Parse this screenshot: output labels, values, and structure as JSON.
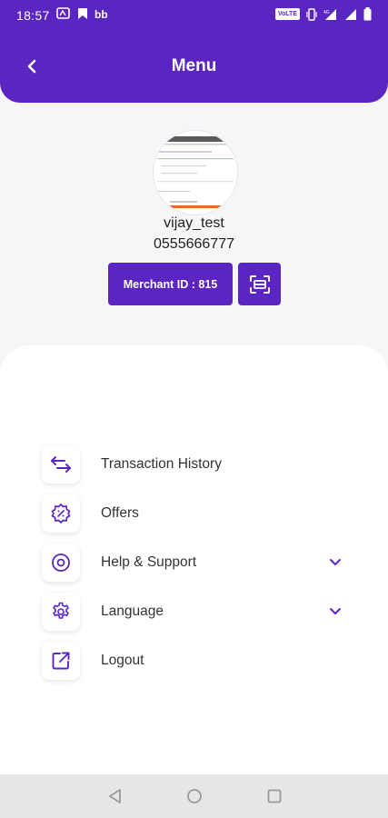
{
  "status_bar": {
    "time": "18:57",
    "volte": "VoLTE"
  },
  "header": {
    "title": "Menu"
  },
  "profile": {
    "username": "vijay_test",
    "phone": "0555666777",
    "merchant_label": "Merchant ID : 815"
  },
  "menu": {
    "items": [
      {
        "label": "Transaction History",
        "icon": "swap-arrows-icon",
        "expandable": false
      },
      {
        "label": "Offers",
        "icon": "offer-badge-icon",
        "expandable": false
      },
      {
        "label": "Help & Support",
        "icon": "help-icon",
        "expandable": true
      },
      {
        "label": "Language",
        "icon": "gear-icon",
        "expandable": true
      },
      {
        "label": "Logout",
        "icon": "external-link-icon",
        "expandable": false
      }
    ]
  },
  "colors": {
    "brand": "#5b25c2",
    "background": "#f6f6f8",
    "card": "#ffffff",
    "navbar": "#e6e6e6"
  }
}
